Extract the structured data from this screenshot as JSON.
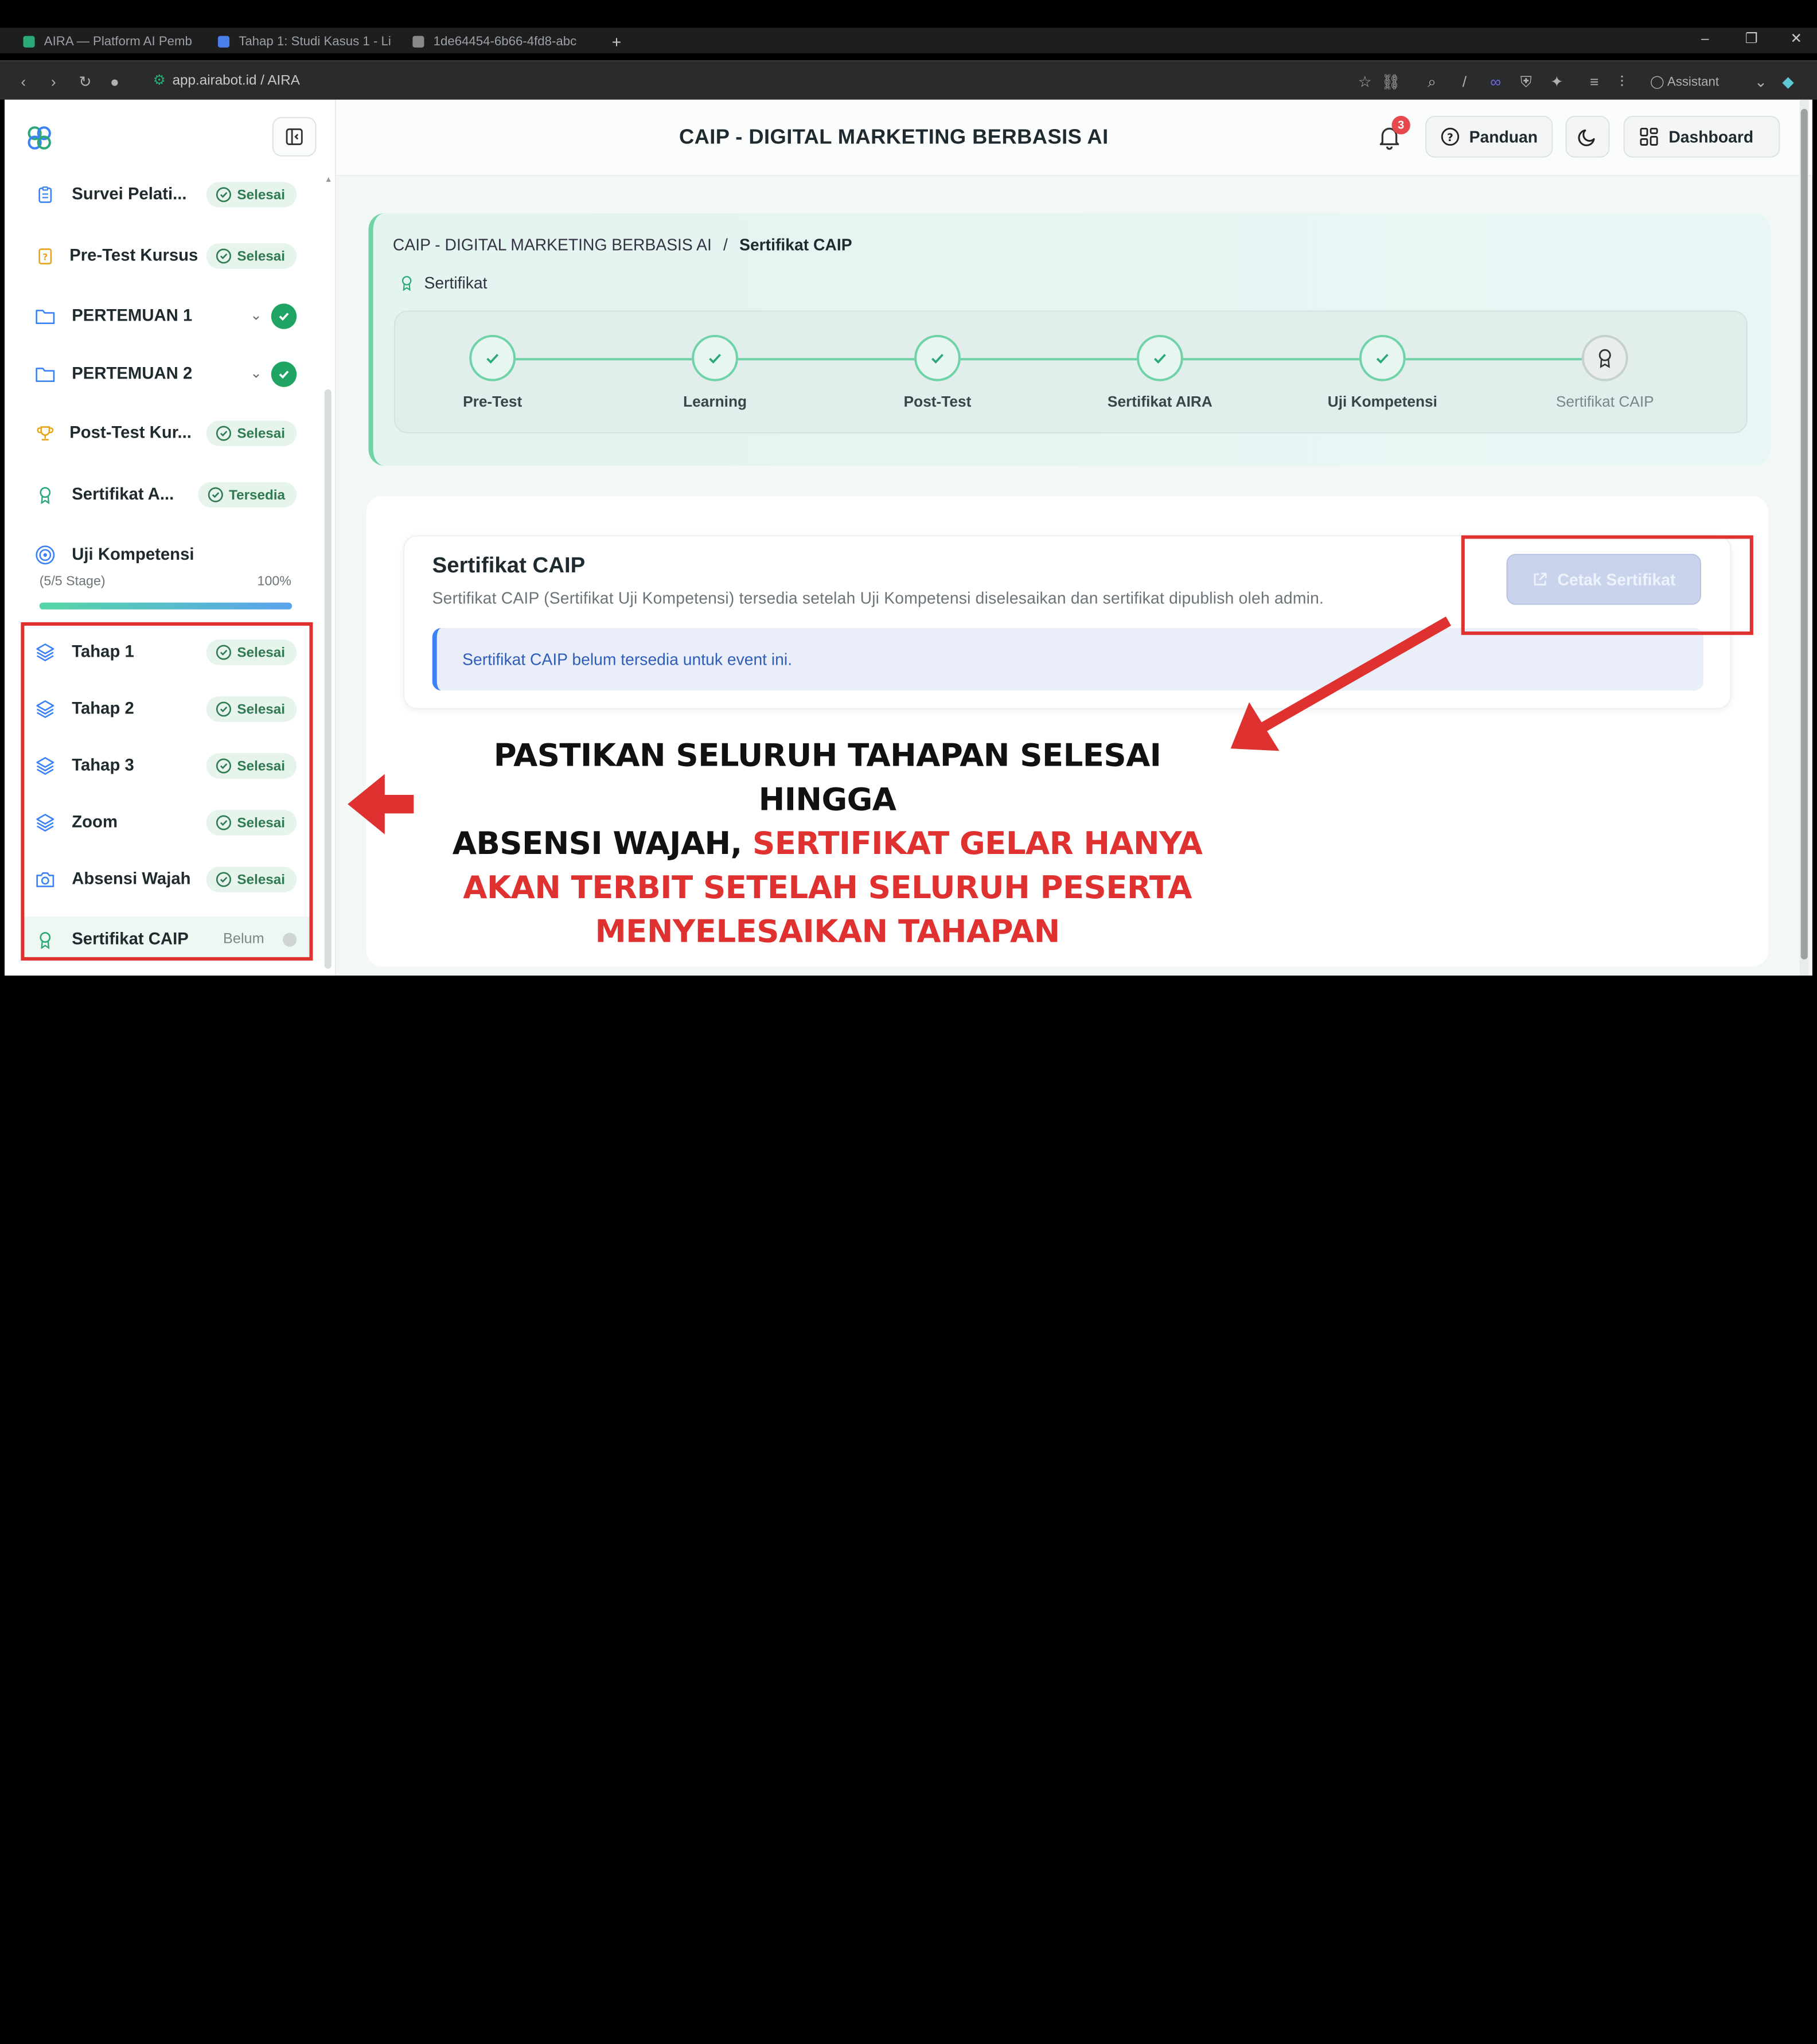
{
  "browser": {
    "tabs": [
      {
        "label": "AIRA — Platform AI Pemb"
      },
      {
        "label": "Tahap 1: Studi Kasus 1 - Li"
      },
      {
        "label": "1de64454-6b66-4fd8-abc"
      }
    ],
    "new_tab": "+",
    "url": "app.airabot.id / AIRA",
    "assistant_label": "Assistant"
  },
  "header": {
    "title": "CAIP - DIGITAL MARKETING BERBASIS AI",
    "notification_count": "3",
    "panduan_label": "Panduan",
    "dashboard_label": "Dashboard"
  },
  "sidebar": {
    "items": [
      {
        "label": "Survei Pelati...",
        "badge": "Selesai",
        "icon": "clipboard-icon"
      },
      {
        "label": "Pre-Test Kursus",
        "badge": "Selesai",
        "icon": "quiz-icon"
      },
      {
        "label": "PERTEMUAN 1",
        "icon": "folder-icon"
      },
      {
        "label": "PERTEMUAN 2",
        "icon": "folder-icon"
      },
      {
        "label": "Post-Test Kur...",
        "badge": "Selesai",
        "icon": "trophy-icon"
      },
      {
        "label": "Sertifikat A...",
        "badge": "Tersedia",
        "icon": "award-icon"
      },
      {
        "label": "Uji Kompetensi",
        "icon": "target-icon"
      }
    ],
    "uji_progress_label": "(5/5 Stage)",
    "uji_progress_pct": "100%",
    "uji_progress_value": 1.0,
    "stages": [
      {
        "label": "Tahap 1",
        "badge": "Selesai",
        "icon": "layers-icon"
      },
      {
        "label": "Tahap 2",
        "badge": "Selesai",
        "icon": "layers-icon"
      },
      {
        "label": "Tahap 3",
        "badge": "Selesai",
        "icon": "layers-icon"
      },
      {
        "label": "Zoom",
        "badge": "Selesai",
        "icon": "layers-icon"
      },
      {
        "label": "Absensi Wajah",
        "badge": "Selesai",
        "icon": "camera-icon"
      },
      {
        "label": "Sertifikat CAIP",
        "badge": "Belum",
        "icon": "award-icon"
      }
    ]
  },
  "breadcrumb": {
    "parent": "CAIP - DIGITAL MARKETING BERBASIS AI",
    "separator": "/",
    "current": "Sertifikat CAIP",
    "section": "Sertifikat"
  },
  "stepper": {
    "steps": [
      {
        "label": "Pre-Test",
        "done": true
      },
      {
        "label": "Learning",
        "done": true
      },
      {
        "label": "Post-Test",
        "done": true
      },
      {
        "label": "Sertifikat AIRA",
        "done": true
      },
      {
        "label": "Uji Kompetensi",
        "done": true
      },
      {
        "label": "Sertifikat CAIP",
        "done": false
      }
    ]
  },
  "certificate": {
    "title": "Sertifikat CAIP",
    "description": "Sertifikat CAIP (Sertifikat Uji Kompetensi) tersedia setelah Uji Kompetensi diselesaikan dan sertifikat dipublish oleh admin.",
    "alert": "Sertifikat CAIP belum tersedia untuk event ini.",
    "print_button": "Cetak Sertifikat"
  },
  "annotation": {
    "line1": "PASTIKAN SELURUH TAHAPAN SELESAI HINGGA",
    "line2_black": "ABSENSI WAJAH, ",
    "line2_red": "SERTIFIKAT GELAR HANYA",
    "line3_red": "AKAN TERBIT SETELAH SELURUH PESERTA",
    "line4_red": "MENYELESAIKAN TAHAPAN"
  },
  "colors": {
    "accent_green": "#6fd3a7",
    "success_green": "#1fa463",
    "annotation_red": "#e03131",
    "info_blue": "#3b82f6"
  }
}
